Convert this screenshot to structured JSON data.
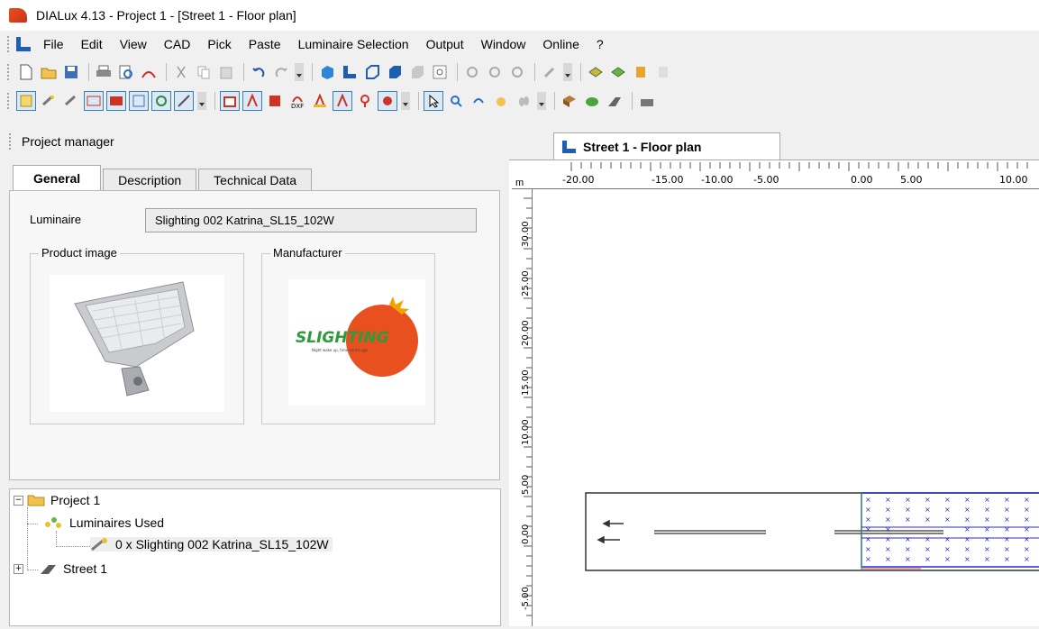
{
  "window": {
    "title": "DIALux 4.13 - Project 1 - [Street 1 - Floor plan]"
  },
  "menu": [
    "File",
    "Edit",
    "View",
    "CAD",
    "Pick",
    "Paste",
    "Luminaire Selection",
    "Output",
    "Window",
    "Online",
    "?"
  ],
  "toolbar1_icons": [
    "new-icon",
    "open-icon",
    "save-icon",
    "print-icon",
    "print-preview-icon",
    "pdf-icon",
    "cut-icon",
    "copy-icon",
    "paste-icon",
    "undo-icon",
    "redo-icon",
    "view-3d-icon",
    "floor-plan-icon",
    "front-view-icon",
    "side-view-icon",
    "view-icon",
    "zoom-window-icon",
    "link-icon",
    "rotate-icon",
    "select-icon",
    "tool-icon",
    "calc-icon",
    "calc-all-icon",
    "folder-icon",
    "report-icon"
  ],
  "toolbar2_icons": [
    "select-luminaire-icon",
    "insert-luminaire-icon",
    "insert-arrangement-icon",
    "field-arrangement-icon",
    "line-arrangement-icon",
    "circle-arrangement-icon",
    "point-arrangement-icon",
    "align-icon",
    "calc-surface-icon",
    "calc-grid-icon",
    "measure-icon",
    "dxf-icon",
    "observer-icon",
    "grid-icon",
    "point-icon",
    "isolux-icon",
    "pointer-icon",
    "zoom-icon",
    "rotate-view-icon",
    "pan-icon",
    "walk-icon",
    "object-icon",
    "tree-icon",
    "street-icon",
    "wall-icon"
  ],
  "project_manager": {
    "title": "Project manager",
    "tabs": [
      "General",
      "Description",
      "Technical Data"
    ],
    "active_tab": "General",
    "luminaire_label": "Luminaire",
    "luminaire_value": "Slighting 002 Katrina_SL15_102W",
    "product_image_label": "Product image",
    "manufacturer_label": "Manufacturer",
    "manufacturer_logo_text": "SLIGHTING",
    "manufacturer_tagline": "Night wake up, time smart age"
  },
  "tree": {
    "project": "Project 1",
    "luminaires_used": "Luminaires Used",
    "luminaire_item": "0 x Slighting 002 Katrina_SL15_102W",
    "street": "Street 1"
  },
  "document": {
    "tab": "Street 1 - Floor plan",
    "unit": "m",
    "ruler_h": [
      "-20.00",
      "-15.00",
      "-10.00",
      "-5.00",
      "0.00",
      "5.00",
      "10.00"
    ],
    "ruler_v": [
      "30.00",
      "25.00",
      "20.00",
      "15.00",
      "10.00",
      "5.00",
      "0.00",
      "-5.00"
    ]
  },
  "colors": {
    "accent": "#1e5fb4",
    "logo_orange": "#e8501f",
    "street_outline": "#333333",
    "grid_blue": "#2b2bc8"
  }
}
